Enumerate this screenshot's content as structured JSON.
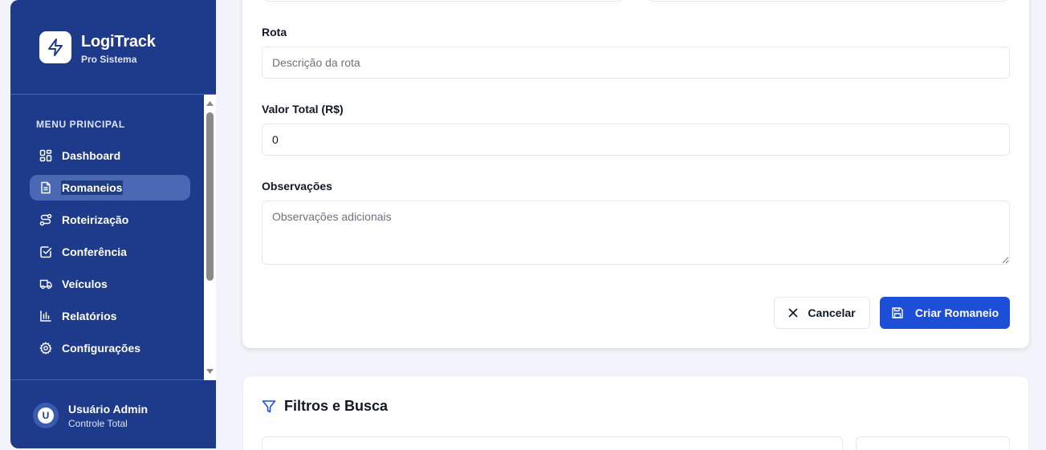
{
  "brand": {
    "title": "LogiTrack",
    "subtitle": "Pro Sistema",
    "icon": "lightning-icon"
  },
  "sidebar": {
    "heading": "MENU PRINCIPAL",
    "items": [
      {
        "label": "Dashboard",
        "icon": "dashboard-grid-icon",
        "active": false
      },
      {
        "label": "Romaneios",
        "icon": "document-icon",
        "active": true
      },
      {
        "label": "Roteirização",
        "icon": "route-icon",
        "active": false
      },
      {
        "label": "Conferência",
        "icon": "check-square-icon",
        "active": false
      },
      {
        "label": "Veículos",
        "icon": "truck-icon",
        "active": false
      },
      {
        "label": "Relatórios",
        "icon": "bar-chart-icon",
        "active": false
      },
      {
        "label": "Configurações",
        "icon": "gear-icon",
        "active": false
      }
    ]
  },
  "user": {
    "initial": "U",
    "name": "Usuário Admin",
    "role": "Controle Total"
  },
  "form": {
    "route": {
      "label": "Rota",
      "placeholder": "Descrição da rota",
      "value": ""
    },
    "total": {
      "label": "Valor Total (R$)",
      "value": "0"
    },
    "notes": {
      "label": "Observações",
      "placeholder": "Observações adicionais",
      "value": ""
    },
    "cancel_label": "Cancelar",
    "create_label": "Criar Romaneio"
  },
  "filters": {
    "title": "Filtros e Busca"
  },
  "colors": {
    "sidebar": "#1e3a8a",
    "primary": "#1d4ed8",
    "active_item": "#4a68b3"
  }
}
